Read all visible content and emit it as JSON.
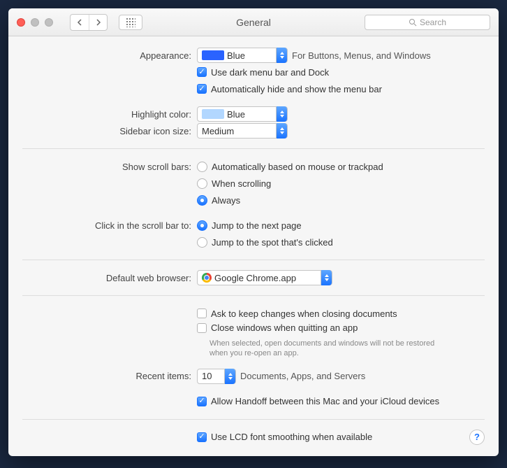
{
  "window": {
    "title": "General",
    "search_placeholder": "Search"
  },
  "appearance": {
    "label": "Appearance:",
    "value": "Blue",
    "hint": "For Buttons, Menus, and Windows",
    "dark_menu": "Use dark menu bar and Dock",
    "auto_hide": "Automatically hide and show the menu bar"
  },
  "highlight": {
    "label": "Highlight color:",
    "value": "Blue"
  },
  "sidebar": {
    "label": "Sidebar icon size:",
    "value": "Medium"
  },
  "scrollbars": {
    "label": "Show scroll bars:",
    "opt_auto": "Automatically based on mouse or trackpad",
    "opt_scroll": "When scrolling",
    "opt_always": "Always"
  },
  "click_scroll": {
    "label": "Click in the scroll bar to:",
    "opt_jump_next": "Jump to the next page",
    "opt_jump_spot": "Jump to the spot that's clicked"
  },
  "browser": {
    "label": "Default web browser:",
    "value": "Google Chrome.app"
  },
  "documents": {
    "ask_changes": "Ask to keep changes when closing documents",
    "close_windows": "Close windows when quitting an app",
    "close_hint": "When selected, open documents and windows will not be restored when you re-open an app."
  },
  "recent": {
    "label": "Recent items:",
    "value": "10",
    "hint": "Documents, Apps, and Servers"
  },
  "handoff": {
    "label": "Allow Handoff between this Mac and your iCloud devices"
  },
  "lcd": {
    "label": "Use LCD font smoothing when available"
  },
  "help": "?"
}
